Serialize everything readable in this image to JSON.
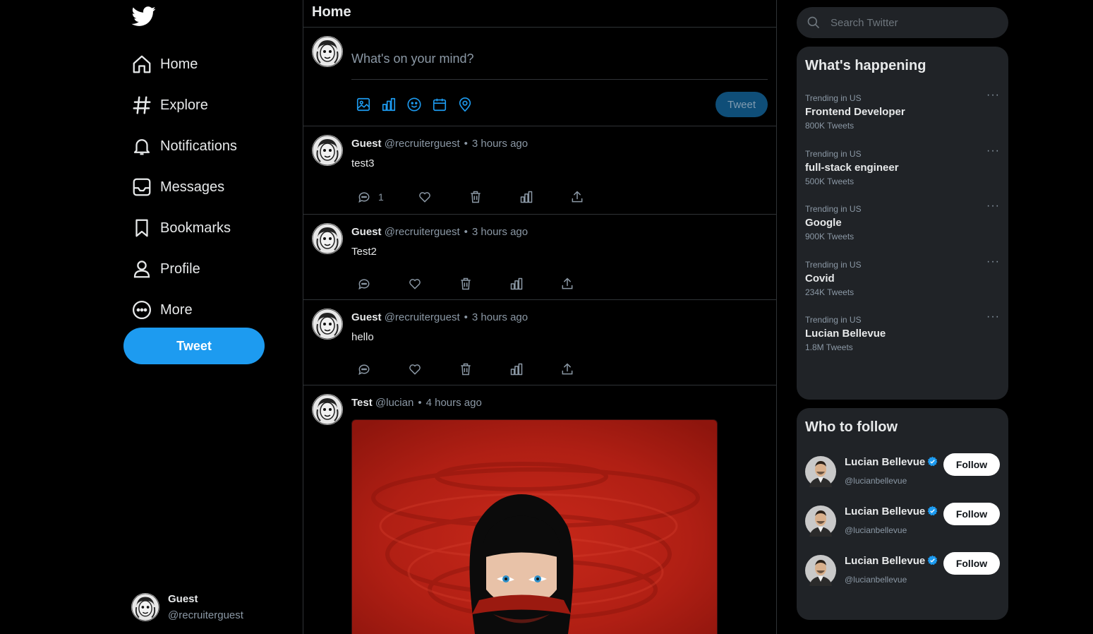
{
  "sidebar": {
    "logo": "twitter-bird-icon",
    "nav": [
      {
        "label": "Home",
        "icon": "home-icon"
      },
      {
        "label": "Explore",
        "icon": "hashtag-icon"
      },
      {
        "label": "Notifications",
        "icon": "bell-icon"
      },
      {
        "label": "Messages",
        "icon": "inbox-icon"
      },
      {
        "label": "Bookmarks",
        "icon": "bookmark-icon"
      },
      {
        "label": "Profile",
        "icon": "user-icon"
      },
      {
        "label": "More",
        "icon": "more-circle-icon"
      }
    ],
    "tweet_label": "Tweet",
    "user": {
      "name": "Guest",
      "handle": "@recruiterguest"
    }
  },
  "main": {
    "title": "Home",
    "composer": {
      "placeholder": "What's on your mind?",
      "tweet_label": "Tweet",
      "tools": [
        "image-icon",
        "poll-icon",
        "emoji-icon",
        "schedule-icon",
        "location-icon"
      ]
    },
    "posts": [
      {
        "name": "Guest",
        "handle": "@recruiterguest",
        "dot": "•",
        "time": "3 hours ago",
        "text": "test3",
        "reply_count": "1"
      },
      {
        "name": "Guest",
        "handle": "@recruiterguest",
        "dot": "•",
        "time": "3 hours ago",
        "text": "Test2",
        "reply_count": ""
      },
      {
        "name": "Guest",
        "handle": "@recruiterguest",
        "dot": "•",
        "time": "3 hours ago",
        "text": "hello",
        "reply_count": ""
      },
      {
        "name": "Test",
        "handle": "@lucian",
        "dot": "•",
        "time": "4 hours ago",
        "text": "",
        "reply_count": ""
      }
    ]
  },
  "right": {
    "search_placeholder": "Search Twitter",
    "happening": {
      "title": "What's happening",
      "more": "···",
      "trends": [
        {
          "category": "Trending in US",
          "topic": "Frontend Developer",
          "count": "800K Tweets"
        },
        {
          "category": "Trending in US",
          "topic": "full-stack engineer",
          "count": "500K Tweets"
        },
        {
          "category": "Trending in US",
          "topic": "Google",
          "count": "900K Tweets"
        },
        {
          "category": "Trending in US",
          "topic": "Covid",
          "count": "234K Tweets"
        },
        {
          "category": "Trending in US",
          "topic": "Lucian Bellevue",
          "count": "1.8M Tweets"
        }
      ]
    },
    "follow": {
      "title": "Who to follow",
      "button_label": "Follow",
      "users": [
        {
          "name": "Lucian Bellevue",
          "handle": "@lucianbellevue"
        },
        {
          "name": "Lucian Bellevue",
          "handle": "@lucianbellevue"
        },
        {
          "name": "Lucian Bellevue",
          "handle": "@lucianbellevue"
        }
      ]
    }
  },
  "colors": {
    "accent": "#1d9bf0",
    "background": "#000000",
    "card": "#202327",
    "border": "#2f3336",
    "muted": "#8b98a5"
  }
}
